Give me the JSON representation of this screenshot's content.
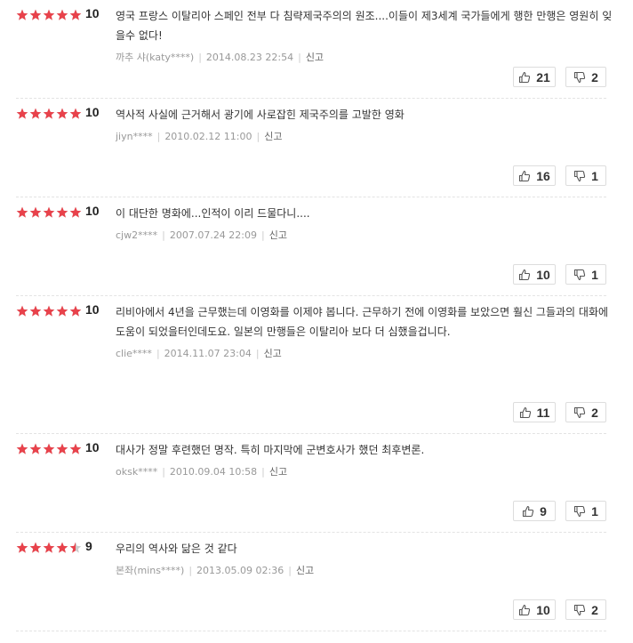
{
  "reviews": [
    {
      "stars": 5,
      "score": "10",
      "text": "영국 프랑스 이탈리아 스페인 전부 다 침략제국주의의 원조....이들이 제3세계 국가들에게 행한 만행은 영원히 잊을수 없다!",
      "author": "까추 샤(katy****)",
      "date": "2014.08.23 22:54",
      "report": "신고",
      "likes": "21",
      "dislikes": "2"
    },
    {
      "stars": 5,
      "score": "10",
      "text": "역사적 사실에 근거해서 광기에 사로잡힌 제국주의를 고발한 영화",
      "author": "jiyn****",
      "date": "2010.02.12 11:00",
      "report": "신고",
      "likes": "16",
      "dislikes": "1"
    },
    {
      "stars": 5,
      "score": "10",
      "text": "이 대단한 명화에...인적이 이리 드물다니....",
      "author": "cjw2****",
      "date": "2007.07.24 22:09",
      "report": "신고",
      "likes": "10",
      "dislikes": "1"
    },
    {
      "stars": 5,
      "score": "10",
      "text": "리비아에서 4년을 근무했는데 이영화를 이제야 봅니다. 근무하기 전에 이영화를 보았으면 훨신 그들과의 대화에 도움이 되었을터인데도요. 일본의 만행들은 이탈리아 보다 더 심했을겁니다.",
      "author": "clie****",
      "date": "2014.11.07 23:04",
      "report": "신고",
      "likes": "11",
      "dislikes": "2"
    },
    {
      "stars": 5,
      "score": "10",
      "text": "대사가 정말 후련했던 명작. 특히 마지막에 군변호사가 했던 최후변론.",
      "author": "oksk****",
      "date": "2010.09.04 10:58",
      "report": "신고",
      "likes": "9",
      "dislikes": "1"
    },
    {
      "stars": 4.5,
      "score": "9",
      "text": "우리의 역사와 닮은 것 같다",
      "author": "본좌(mins****)",
      "date": "2013.05.09 02:36",
      "report": "신고",
      "likes": "10",
      "dislikes": "2"
    }
  ],
  "colors": {
    "star": "#e8424b",
    "star_empty": "#cccccc",
    "meta": "#999999",
    "border": "#dddddd"
  },
  "icons": {
    "like": "thumbs-up-icon",
    "dislike": "thumbs-down-icon",
    "rating": "star-icon"
  }
}
